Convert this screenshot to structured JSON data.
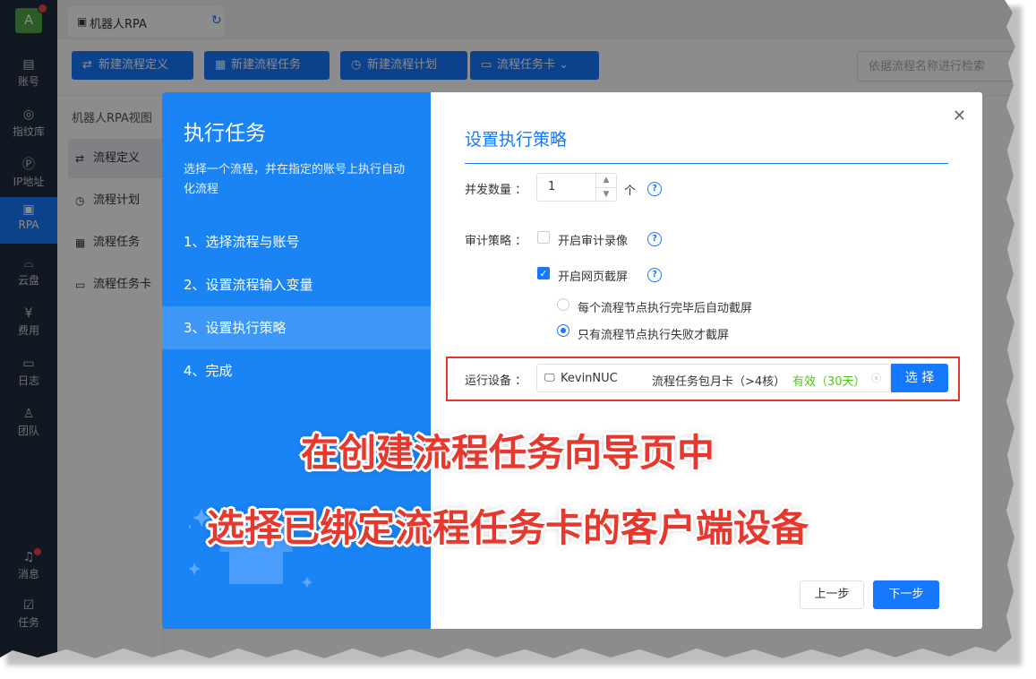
{
  "nav": {
    "avatar_letter": "A",
    "items": [
      {
        "label": "账号",
        "icon": "id-card-icon"
      },
      {
        "label": "指纹库",
        "icon": "fingerprint-icon"
      },
      {
        "label": "IP地址",
        "icon": "ip-icon"
      },
      {
        "label": "RPA",
        "icon": "robot-icon"
      },
      {
        "label": "云盘",
        "icon": "cloud-drive-icon"
      },
      {
        "label": "费用",
        "icon": "yen-icon"
      },
      {
        "label": "日志",
        "icon": "log-icon"
      },
      {
        "label": "团队",
        "icon": "team-icon"
      }
    ],
    "bottom": [
      {
        "label": "消息",
        "icon": "bell-icon"
      },
      {
        "label": "任务",
        "icon": "task-icon"
      }
    ]
  },
  "tab": {
    "label": "机器人RPA"
  },
  "toolbar": {
    "buttons": [
      "新建流程定义",
      "新建流程任务",
      "新建流程计划",
      "流程任务卡"
    ],
    "search_placeholder": "依据流程名称进行检索"
  },
  "sideview": {
    "title": "机器人RPA视图",
    "items": [
      "流程定义",
      "流程计划",
      "流程任务",
      "流程任务卡"
    ]
  },
  "modal": {
    "title": "执行任务",
    "desc": "选择一个流程，并在指定的账号上执行自动化流程",
    "steps": [
      "1、选择流程与账号",
      "2、设置流程输入变量",
      "3、设置执行策略",
      "4、完成"
    ],
    "section_title": "设置执行策略",
    "concurrency": {
      "label": "并发数量",
      "value": "1",
      "unit": "个"
    },
    "audit": {
      "label": "审计策略",
      "record_label": "开启审计录像",
      "record_checked": false,
      "screenshot_label": "开启网页截屏",
      "screenshot_checked": true,
      "radio_each": "每个流程节点执行完毕后自动截屏",
      "radio_fail": "只有流程节点执行失败才截屏",
      "selected": "fail"
    },
    "device": {
      "label": "运行设备",
      "name": "KevinNUC",
      "card": "流程任务包月卡（>4核）",
      "status": "有效（30天）",
      "select_label": "选 择"
    },
    "prev_label": "上一步",
    "next_label": "下一步"
  },
  "annotation": {
    "line1": "在创建流程任务向导页中",
    "line2": "选择已绑定流程任务卡的客户端设备"
  },
  "colors": {
    "primary": "#1677ff",
    "modal_left": "#1a84f5",
    "annotation": "#e8372d",
    "valid": "#52c41a"
  }
}
